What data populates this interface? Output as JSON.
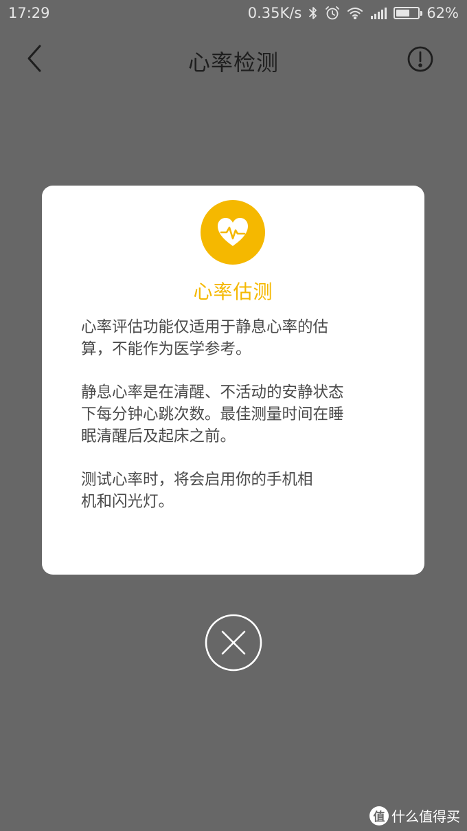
{
  "status_bar": {
    "time": "17:29",
    "network_speed": "0.35K/s",
    "battery_percent": "62%",
    "battery_level": 0.62,
    "icons": [
      "bluetooth-icon",
      "alarm-icon",
      "wifi-icon",
      "signal-icon",
      "battery-icon"
    ]
  },
  "nav": {
    "title": "心率检测",
    "back_icon": "chevron-left-icon",
    "info_icon": "exclamation-circle-icon"
  },
  "dialog": {
    "icon": "heart-pulse-icon",
    "title": "心率估测",
    "paragraphs": [
      [
        "心率评估功能仅适用于静息心率的估",
        "算，不能作为医学参考。"
      ],
      [
        "静息心率是在清醒、不活动的安静状态",
        "下每分钟心跳次数。最佳测量时间在睡",
        "眠清醒后及起床之前。"
      ],
      [
        "测试心率时，将会启用你的手机相",
        "机和闪光灯。"
      ]
    ]
  },
  "close_icon": "close-circle-icon",
  "watermark": {
    "logo_glyph": "值",
    "text": "什么值得买"
  },
  "colors": {
    "accent": "#f5b800",
    "background": "#676767",
    "card": "#ffffff",
    "body_text": "#4a4a4a"
  }
}
